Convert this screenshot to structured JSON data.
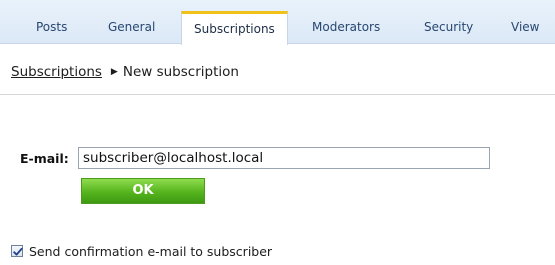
{
  "tabs": [
    {
      "label": "Posts",
      "active": false
    },
    {
      "label": "General",
      "active": false
    },
    {
      "label": "Subscriptions",
      "active": true
    },
    {
      "label": "Moderators",
      "active": false
    },
    {
      "label": "Security",
      "active": false
    },
    {
      "label": "View",
      "active": false
    }
  ],
  "breadcrumb": {
    "parent_label": "Subscriptions",
    "separator_icon": "triangle-right-icon",
    "current_label": "New subscription"
  },
  "form": {
    "email_label": "E-mail:",
    "email_value": "subscriber@localhost.local",
    "ok_label": "OK",
    "send_confirmation": {
      "checked": true,
      "label": "Send confirmation e-mail to subscriber"
    }
  },
  "colors": {
    "active_tab_accent": "#f2c21a",
    "ok_button_green": "#56b41d",
    "tab_text": "#27476f"
  }
}
